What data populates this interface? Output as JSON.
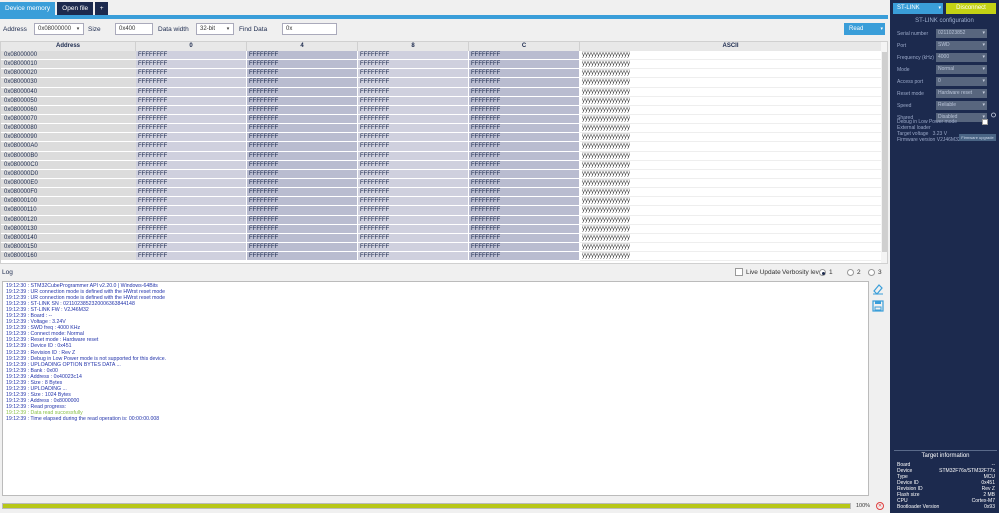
{
  "tabs": {
    "device_memory": "Device memory",
    "open_file": "Open file",
    "add": "+"
  },
  "toolbar": {
    "address_label": "Address",
    "address_value": "0x08000000",
    "size_label": "Size",
    "size_value": "0x400",
    "data_width_label": "Data width",
    "data_width_value": "32-bit",
    "find_label": "Find Data",
    "find_value": "0x",
    "read_label": "Read"
  },
  "memory": {
    "headers": [
      "Address",
      "0",
      "4",
      "8",
      "C",
      "ASCII"
    ],
    "rows": [
      {
        "addr": "0x08000000",
        "v": [
          "FFFFFFFF",
          "FFFFFFFF",
          "FFFFFFFF",
          "FFFFFFFF"
        ],
        "ascii": "ÿÿÿÿÿÿÿÿÿÿÿÿÿÿÿÿ"
      },
      {
        "addr": "0x08000010",
        "v": [
          "FFFFFFFF",
          "FFFFFFFF",
          "FFFFFFFF",
          "FFFFFFFF"
        ],
        "ascii": "ÿÿÿÿÿÿÿÿÿÿÿÿÿÿÿÿ"
      },
      {
        "addr": "0x08000020",
        "v": [
          "FFFFFFFF",
          "FFFFFFFF",
          "FFFFFFFF",
          "FFFFFFFF"
        ],
        "ascii": "ÿÿÿÿÿÿÿÿÿÿÿÿÿÿÿÿ"
      },
      {
        "addr": "0x08000030",
        "v": [
          "FFFFFFFF",
          "FFFFFFFF",
          "FFFFFFFF",
          "FFFFFFFF"
        ],
        "ascii": "ÿÿÿÿÿÿÿÿÿÿÿÿÿÿÿÿ"
      },
      {
        "addr": "0x08000040",
        "v": [
          "FFFFFFFF",
          "FFFFFFFF",
          "FFFFFFFF",
          "FFFFFFFF"
        ],
        "ascii": "ÿÿÿÿÿÿÿÿÿÿÿÿÿÿÿÿ"
      },
      {
        "addr": "0x08000050",
        "v": [
          "FFFFFFFF",
          "FFFFFFFF",
          "FFFFFFFF",
          "FFFFFFFF"
        ],
        "ascii": "ÿÿÿÿÿÿÿÿÿÿÿÿÿÿÿÿ"
      },
      {
        "addr": "0x08000060",
        "v": [
          "FFFFFFFF",
          "FFFFFFFF",
          "FFFFFFFF",
          "FFFFFFFF"
        ],
        "ascii": "ÿÿÿÿÿÿÿÿÿÿÿÿÿÿÿÿ"
      },
      {
        "addr": "0x08000070",
        "v": [
          "FFFFFFFF",
          "FFFFFFFF",
          "FFFFFFFF",
          "FFFFFFFF"
        ],
        "ascii": "ÿÿÿÿÿÿÿÿÿÿÿÿÿÿÿÿ"
      },
      {
        "addr": "0x08000080",
        "v": [
          "FFFFFFFF",
          "FFFFFFFF",
          "FFFFFFFF",
          "FFFFFFFF"
        ],
        "ascii": "ÿÿÿÿÿÿÿÿÿÿÿÿÿÿÿÿ"
      },
      {
        "addr": "0x08000090",
        "v": [
          "FFFFFFFF",
          "FFFFFFFF",
          "FFFFFFFF",
          "FFFFFFFF"
        ],
        "ascii": "ÿÿÿÿÿÿÿÿÿÿÿÿÿÿÿÿ"
      },
      {
        "addr": "0x080000A0",
        "v": [
          "FFFFFFFF",
          "FFFFFFFF",
          "FFFFFFFF",
          "FFFFFFFF"
        ],
        "ascii": "ÿÿÿÿÿÿÿÿÿÿÿÿÿÿÿÿ"
      },
      {
        "addr": "0x080000B0",
        "v": [
          "FFFFFFFF",
          "FFFFFFFF",
          "FFFFFFFF",
          "FFFFFFFF"
        ],
        "ascii": "ÿÿÿÿÿÿÿÿÿÿÿÿÿÿÿÿ"
      },
      {
        "addr": "0x080000C0",
        "v": [
          "FFFFFFFF",
          "FFFFFFFF",
          "FFFFFFFF",
          "FFFFFFFF"
        ],
        "ascii": "ÿÿÿÿÿÿÿÿÿÿÿÿÿÿÿÿ"
      },
      {
        "addr": "0x080000D0",
        "v": [
          "FFFFFFFF",
          "FFFFFFFF",
          "FFFFFFFF",
          "FFFFFFFF"
        ],
        "ascii": "ÿÿÿÿÿÿÿÿÿÿÿÿÿÿÿÿ"
      },
      {
        "addr": "0x080000E0",
        "v": [
          "FFFFFFFF",
          "FFFFFFFF",
          "FFFFFFFF",
          "FFFFFFFF"
        ],
        "ascii": "ÿÿÿÿÿÿÿÿÿÿÿÿÿÿÿÿ"
      },
      {
        "addr": "0x080000F0",
        "v": [
          "FFFFFFFF",
          "FFFFFFFF",
          "FFFFFFFF",
          "FFFFFFFF"
        ],
        "ascii": "ÿÿÿÿÿÿÿÿÿÿÿÿÿÿÿÿ"
      },
      {
        "addr": "0x08000100",
        "v": [
          "FFFFFFFF",
          "FFFFFFFF",
          "FFFFFFFF",
          "FFFFFFFF"
        ],
        "ascii": "ÿÿÿÿÿÿÿÿÿÿÿÿÿÿÿÿ"
      },
      {
        "addr": "0x08000110",
        "v": [
          "FFFFFFFF",
          "FFFFFFFF",
          "FFFFFFFF",
          "FFFFFFFF"
        ],
        "ascii": "ÿÿÿÿÿÿÿÿÿÿÿÿÿÿÿÿ"
      },
      {
        "addr": "0x08000120",
        "v": [
          "FFFFFFFF",
          "FFFFFFFF",
          "FFFFFFFF",
          "FFFFFFFF"
        ],
        "ascii": "ÿÿÿÿÿÿÿÿÿÿÿÿÿÿÿÿ"
      },
      {
        "addr": "0x08000130",
        "v": [
          "FFFFFFFF",
          "FFFFFFFF",
          "FFFFFFFF",
          "FFFFFFFF"
        ],
        "ascii": "ÿÿÿÿÿÿÿÿÿÿÿÿÿÿÿÿ"
      },
      {
        "addr": "0x08000140",
        "v": [
          "FFFFFFFF",
          "FFFFFFFF",
          "FFFFFFFF",
          "FFFFFFFF"
        ],
        "ascii": "ÿÿÿÿÿÿÿÿÿÿÿÿÿÿÿÿ"
      },
      {
        "addr": "0x08000150",
        "v": [
          "FFFFFFFF",
          "FFFFFFFF",
          "FFFFFFFF",
          "FFFFFFFF"
        ],
        "ascii": "ÿÿÿÿÿÿÿÿÿÿÿÿÿÿÿÿ"
      },
      {
        "addr": "0x08000160",
        "v": [
          "FFFFFFFF",
          "FFFFFFFF",
          "FFFFFFFF",
          "FFFFFFFF"
        ],
        "ascii": "ÿÿÿÿÿÿÿÿÿÿÿÿÿÿÿÿ"
      }
    ]
  },
  "log": {
    "label": "Log",
    "live_update": "Live Update",
    "verbosity_label": "Verbosity level",
    "verbosity_options": [
      "1",
      "2",
      "3"
    ],
    "verbosity_selected": "1",
    "lines": [
      {
        "t": "19:12:30 : STM32CubeProgrammer API v2.20.0 | Windows-64Bits",
        "ok": false
      },
      {
        "t": "19:12:39 : UR connection mode is defined with the HWrst reset mode",
        "ok": false
      },
      {
        "t": "19:12:39 : UR connection mode is defined with the HWrst reset mode",
        "ok": false
      },
      {
        "t": "19:12:39 : ST-LINK SN  : 0211023852320006363844148",
        "ok": false
      },
      {
        "t": "19:12:39 : ST-LINK FW  : V2J46M32",
        "ok": false
      },
      {
        "t": "19:12:39 : Board        : --",
        "ok": false
      },
      {
        "t": "19:12:39 : Voltage      : 3.24V",
        "ok": false
      },
      {
        "t": "19:12:39 : SWD freq     : 4000 KHz",
        "ok": false
      },
      {
        "t": "19:12:39 : Connect mode: Normal",
        "ok": false
      },
      {
        "t": "19:12:39 : Reset mode   : Hardware reset",
        "ok": false
      },
      {
        "t": "19:12:39 : Device ID    : 0x451",
        "ok": false
      },
      {
        "t": "19:12:39 : Revision ID  : Rev Z",
        "ok": false
      },
      {
        "t": "19:12:39 : Debug in Low Power mode is not supported for this device.",
        "ok": false
      },
      {
        "t": "19:12:39 : UPLOADING OPTION BYTES DATA ...",
        "ok": false
      },
      {
        "t": "19:12:39 :   Bank         : 0x00",
        "ok": false
      },
      {
        "t": "19:12:39 :   Address      : 0x40023c14",
        "ok": false
      },
      {
        "t": "19:12:39 :   Size         : 8 Bytes",
        "ok": false
      },
      {
        "t": "19:12:39 : UPLOADING ...",
        "ok": false
      },
      {
        "t": "19:12:39 :   Size         : 1024 Bytes",
        "ok": false
      },
      {
        "t": "19:12:39 :   Address      : 0x8000000",
        "ok": false
      },
      {
        "t": "19:12:39 : Read progress:",
        "ok": false
      },
      {
        "t": "19:12:39 : Data read successfully",
        "ok": true
      },
      {
        "t": "19:12:39 : Time elapsed during the read operation is: 00:00:00.008",
        "ok": false
      }
    ]
  },
  "progress": {
    "value": 100,
    "label": "100%"
  },
  "right_panel": {
    "interface": "ST-LINK",
    "disconnect": "Disconnect",
    "config_title": "ST-LINK configuration",
    "fields": [
      {
        "label": "Serial number",
        "value": "0211023852"
      },
      {
        "label": "Port",
        "value": "SWD"
      },
      {
        "label": "Frequency (kHz)",
        "value": "4000"
      },
      {
        "label": "Mode",
        "value": "Normal"
      },
      {
        "label": "Access port",
        "value": "0"
      },
      {
        "label": "Reset mode",
        "value": "Hardware reset"
      },
      {
        "label": "Speed",
        "value": "Reliable"
      },
      {
        "label": "Shared",
        "value": "Disabled"
      }
    ],
    "debug_low_power": "Debug in Low Power mode",
    "external_loader": "External loader",
    "target_voltage_label": "Target voltage",
    "target_voltage": "3.23 V",
    "firmware_label": "Firmware version",
    "firmware": "V2J46M32",
    "firmware_upgrade": "Firmware upgrade",
    "target_title": "Target information",
    "target": [
      {
        "label": "Board",
        "value": "--"
      },
      {
        "label": "Device",
        "value": "STM32F76x/STM32F77x"
      },
      {
        "label": "Type",
        "value": "MCU"
      },
      {
        "label": "Device ID",
        "value": "0x451"
      },
      {
        "label": "Revision ID",
        "value": "Rev Z"
      },
      {
        "label": "Flash size",
        "value": "2 MB"
      },
      {
        "label": "CPU",
        "value": "Cortex-M7"
      },
      {
        "label": "Bootloader Version",
        "value": "0x93"
      }
    ]
  }
}
